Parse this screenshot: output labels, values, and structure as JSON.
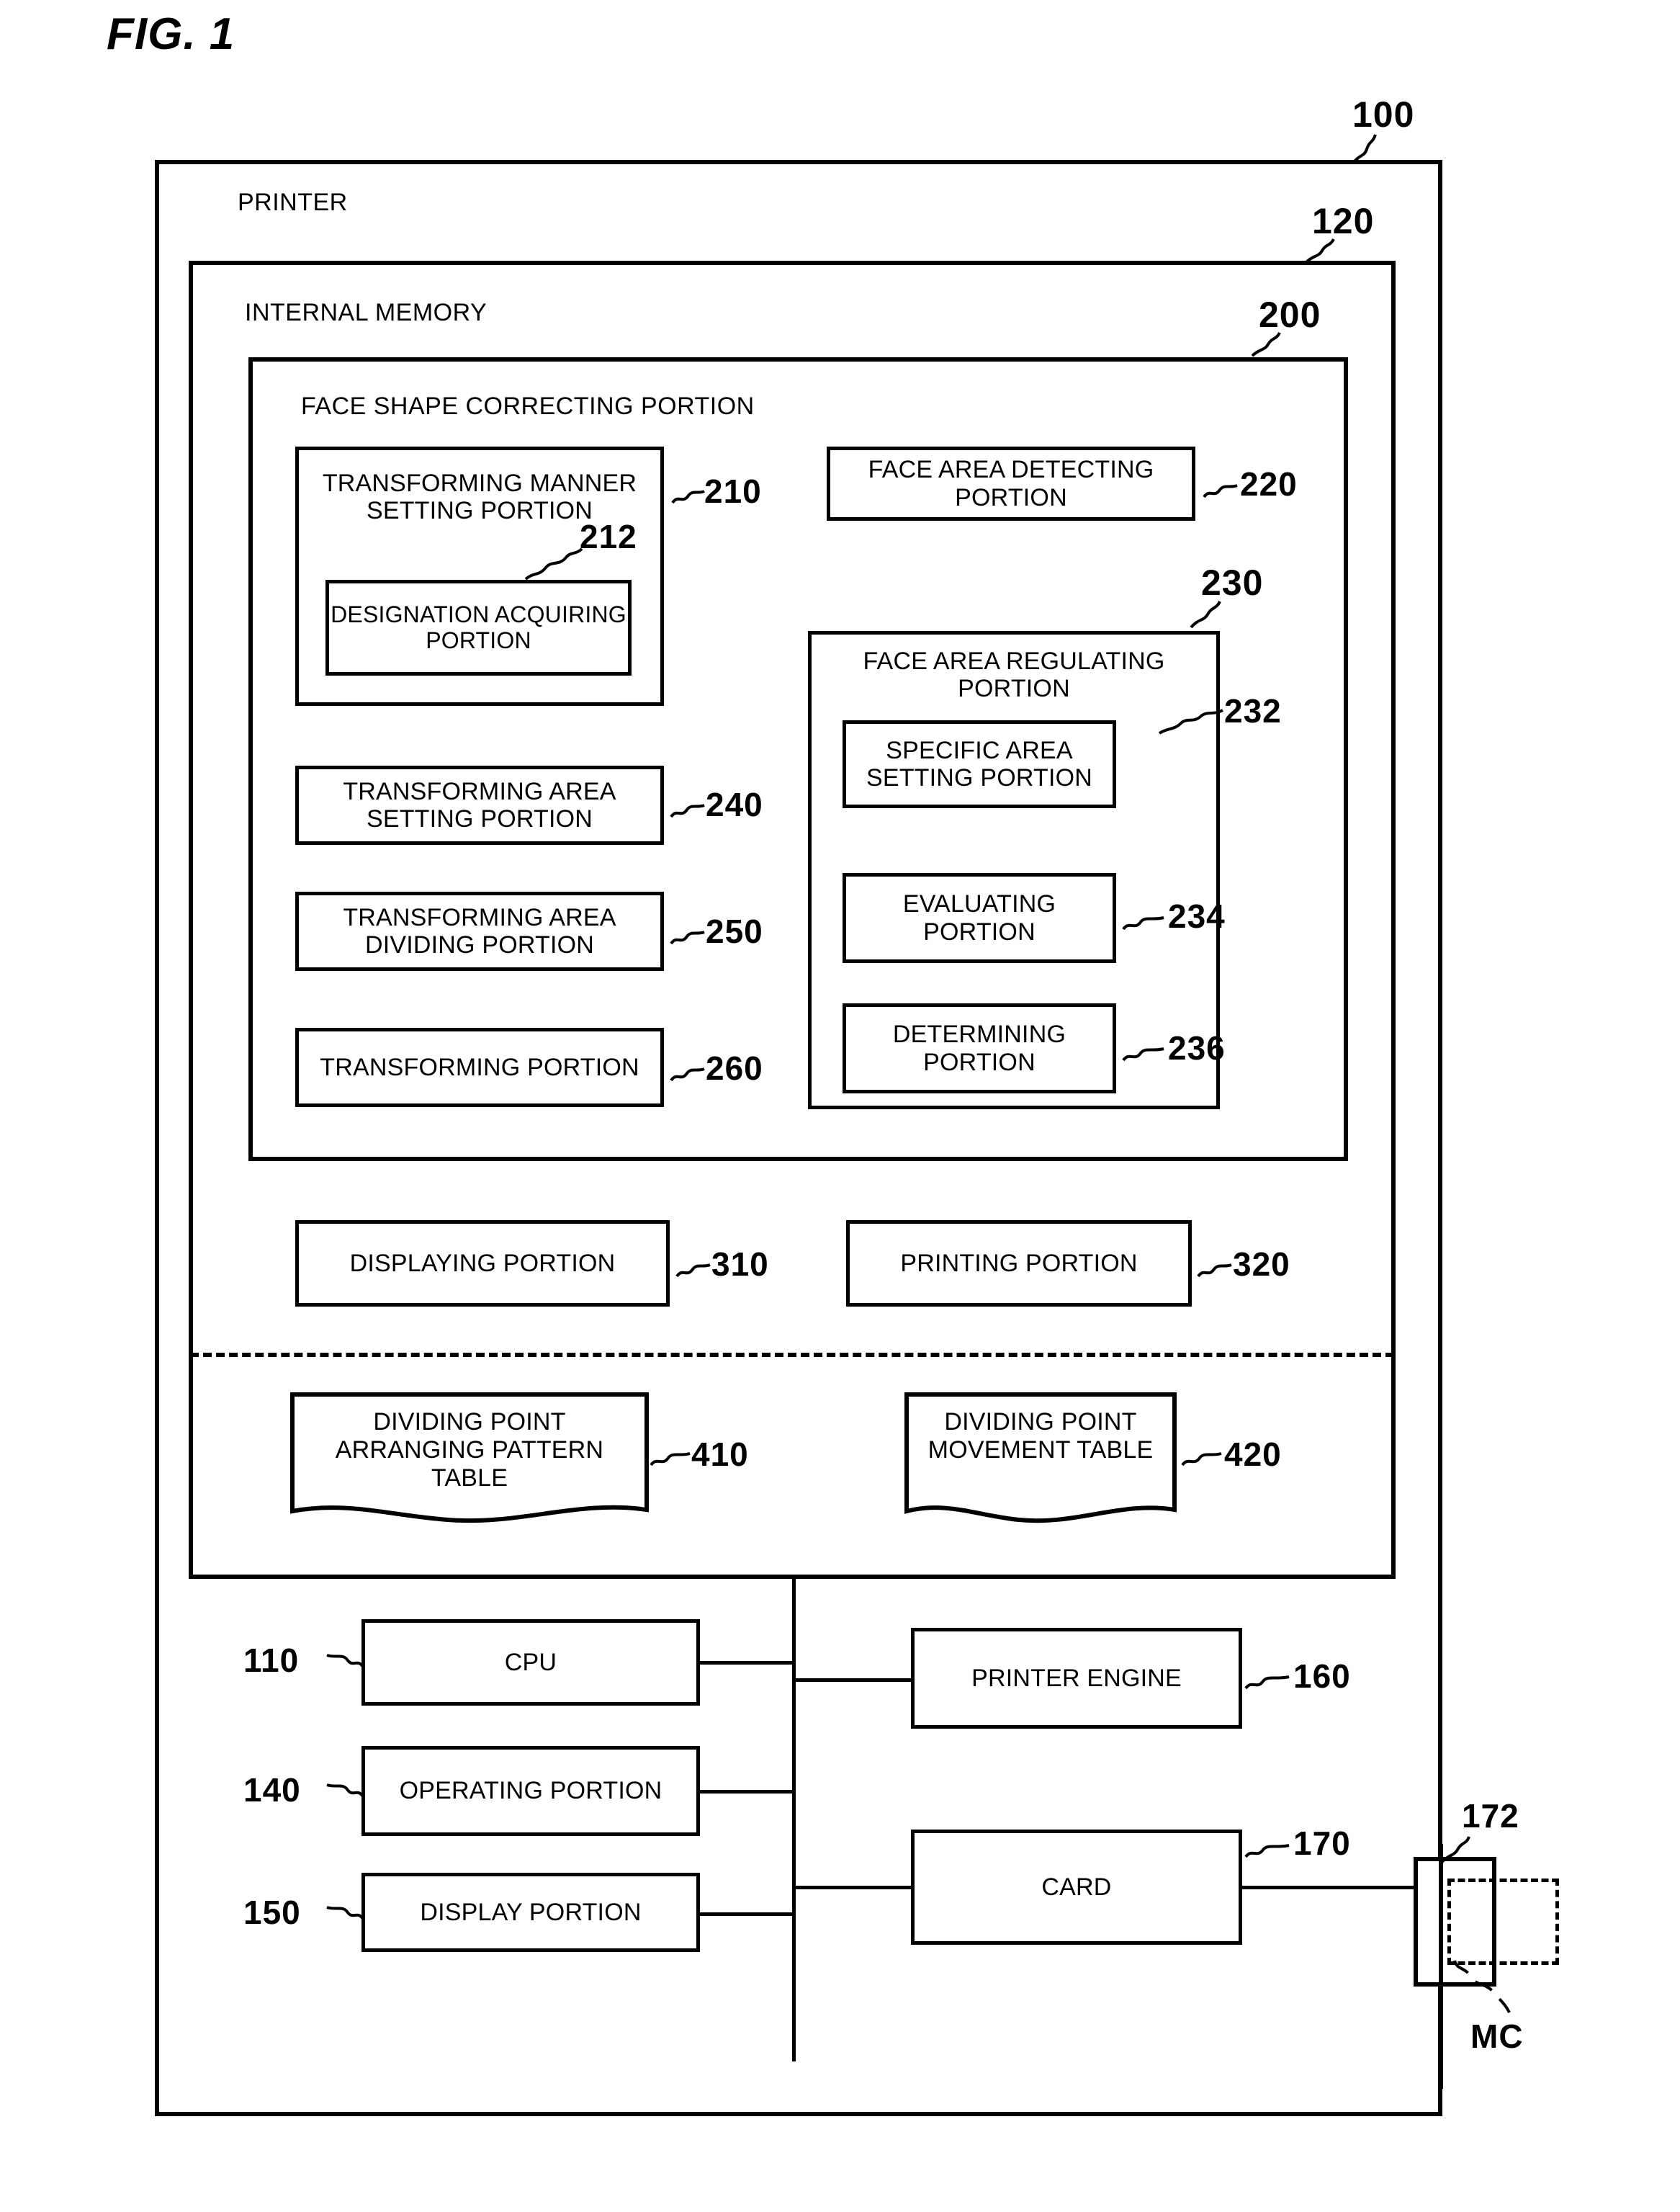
{
  "figure": {
    "title": "FIG. 1"
  },
  "printer": {
    "label": "PRINTER",
    "ref": "100"
  },
  "internal_memory": {
    "label": "INTERNAL MEMORY",
    "ref": "120"
  },
  "face_shape_correcting_portion": {
    "label": "FACE SHAPE CORRECTING PORTION",
    "ref": "200"
  },
  "modules": {
    "transforming_manner_setting": {
      "label": "TRANSFORMING MANNER SETTING PORTION",
      "ref": "210"
    },
    "designation_acquiring": {
      "label": "DESIGNATION ACQUIRING PORTION",
      "ref": "212"
    },
    "face_area_detecting": {
      "label": "FACE AREA DETECTING PORTION",
      "ref": "220"
    },
    "face_area_regulating": {
      "label": "FACE AREA REGULATING PORTION",
      "ref": "230"
    },
    "specific_area_setting": {
      "label": "SPECIFIC AREA SETTING PORTION",
      "ref": "232"
    },
    "evaluating": {
      "label": "EVALUATING PORTION",
      "ref": "234"
    },
    "determining": {
      "label": "DETERMINING PORTION",
      "ref": "236"
    },
    "transforming_area_setting": {
      "label": "TRANSFORMING AREA SETTING PORTION",
      "ref": "240"
    },
    "transforming_area_dividing": {
      "label": "TRANSFORMING AREA DIVIDING PORTION",
      "ref": "250"
    },
    "transforming": {
      "label": "TRANSFORMING PORTION",
      "ref": "260"
    },
    "displaying": {
      "label": "DISPLAYING PORTION",
      "ref": "310"
    },
    "printing": {
      "label": "PRINTING PORTION",
      "ref": "320"
    }
  },
  "tables": {
    "dividing_point_arranging_pattern": {
      "label": "DIVIDING POINT ARRANGING PATTERN TABLE",
      "ref": "410"
    },
    "dividing_point_movement": {
      "label": "DIVIDING POINT MOVEMENT TABLE",
      "ref": "420"
    }
  },
  "hardware": {
    "cpu": {
      "label": "CPU",
      "ref": "110"
    },
    "operating_portion": {
      "label": "OPERATING PORTION",
      "ref": "140"
    },
    "display_portion": {
      "label": "DISPLAY PORTION",
      "ref": "150"
    },
    "printer_engine": {
      "label": "PRINTER ENGINE",
      "ref": "160"
    },
    "card": {
      "label": "CARD",
      "ref": "170"
    },
    "card_slot": {
      "ref": "172"
    },
    "memory_card": {
      "label": "MC"
    }
  }
}
